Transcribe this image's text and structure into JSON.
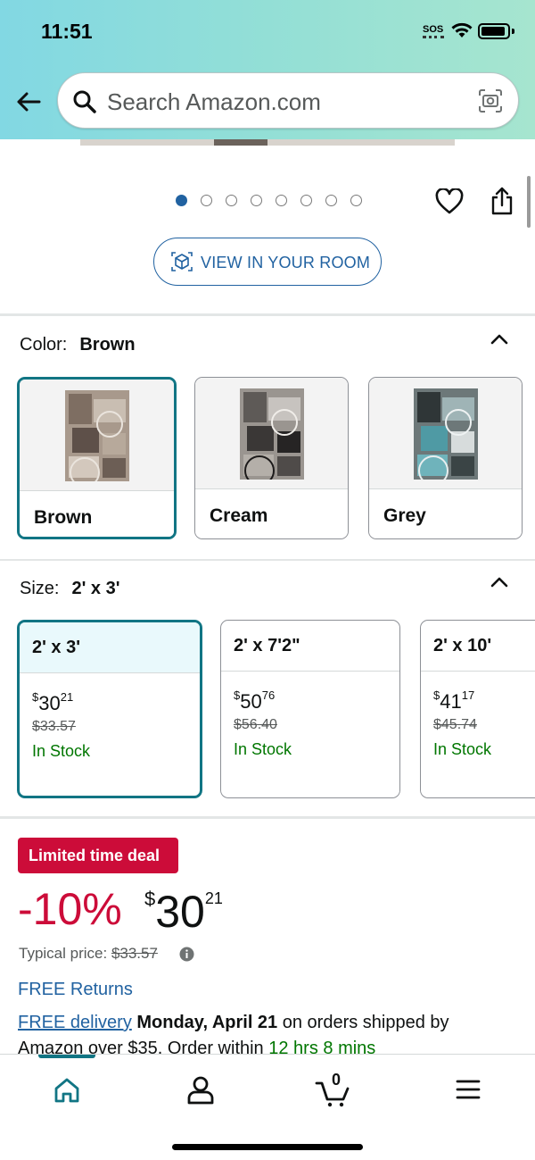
{
  "status_bar": {
    "time": "11:51",
    "sos": "SOS"
  },
  "search": {
    "placeholder": "Search Amazon.com"
  },
  "carousel": {
    "image_count": 8,
    "active_index": 0
  },
  "view_in_room": {
    "label": "VIEW IN YOUR ROOM"
  },
  "color": {
    "label": "Color:",
    "selected": "Brown",
    "options": [
      {
        "label": "Brown"
      },
      {
        "label": "Cream"
      },
      {
        "label": "Grey"
      }
    ]
  },
  "size": {
    "label": "Size:",
    "selected": "2' x 3'",
    "options": [
      {
        "label": "2' x 3'",
        "price_currency": "$",
        "price_whole": "30",
        "price_fraction": "21",
        "list_price": "$33.57",
        "stock": "In Stock"
      },
      {
        "label": "2' x 7'2\"",
        "price_currency": "$",
        "price_whole": "50",
        "price_fraction": "76",
        "list_price": "$56.40",
        "stock": "In Stock"
      },
      {
        "label": "2' x 10'",
        "price_currency": "$",
        "price_whole": "41",
        "price_fraction": "17",
        "list_price": "$45.74",
        "stock": "In Stock"
      }
    ]
  },
  "deal": {
    "badge": "Limited time deal",
    "discount": "-10%",
    "price_currency": "$",
    "price_whole": "30",
    "price_fraction": "21",
    "typical_label": "Typical price:",
    "typical_price": "$33.57"
  },
  "returns": {
    "label": "FREE Returns"
  },
  "delivery": {
    "link": "FREE delivery",
    "date": "Monday, April 21",
    "text1": " on orders shipped by Amazon over $35. Order within ",
    "countdown": "12 hrs 8 mins"
  },
  "bottom_nav": {
    "cart_count": "0"
  },
  "colors": {
    "accent_teal": "#117584",
    "link_blue": "#2162a1",
    "deal_red": "#cc0c39",
    "stock_green": "#007600"
  }
}
